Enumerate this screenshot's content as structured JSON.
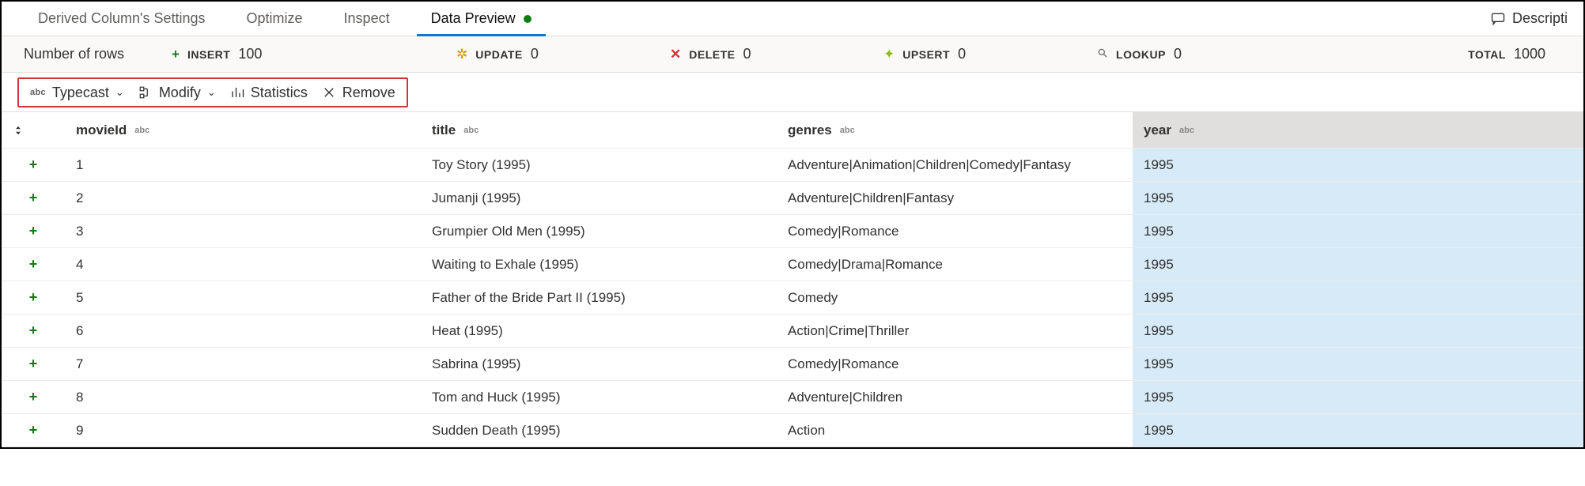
{
  "tabs": {
    "items": [
      {
        "label": "Derived Column's Settings",
        "active": false
      },
      {
        "label": "Optimize",
        "active": false
      },
      {
        "label": "Inspect",
        "active": false
      },
      {
        "label": "Data Preview",
        "active": true,
        "status": "green"
      }
    ],
    "descript_label": "Descripti"
  },
  "stats": {
    "label": "Number of rows",
    "insert": {
      "name": "INSERT",
      "value": "100"
    },
    "update": {
      "name": "UPDATE",
      "value": "0"
    },
    "delete": {
      "name": "DELETE",
      "value": "0"
    },
    "upsert": {
      "name": "UPSERT",
      "value": "0"
    },
    "lookup": {
      "name": "LOOKUP",
      "value": "0"
    },
    "total": {
      "name": "TOTAL",
      "value": "1000"
    }
  },
  "toolbar": {
    "typecast": "Typecast",
    "modify": "Modify",
    "statistics": "Statistics",
    "remove": "Remove"
  },
  "columns": [
    {
      "name": "movieId",
      "type": "abc",
      "highlight": false
    },
    {
      "name": "title",
      "type": "abc",
      "highlight": false
    },
    {
      "name": "genres",
      "type": "abc",
      "highlight": false
    },
    {
      "name": "year",
      "type": "abc",
      "highlight": true
    }
  ],
  "rows": [
    {
      "movieId": "1",
      "title": "Toy Story (1995)",
      "genres": "Adventure|Animation|Children|Comedy|Fantasy",
      "year": "1995"
    },
    {
      "movieId": "2",
      "title": "Jumanji (1995)",
      "genres": "Adventure|Children|Fantasy",
      "year": "1995"
    },
    {
      "movieId": "3",
      "title": "Grumpier Old Men (1995)",
      "genres": "Comedy|Romance",
      "year": "1995"
    },
    {
      "movieId": "4",
      "title": "Waiting to Exhale (1995)",
      "genres": "Comedy|Drama|Romance",
      "year": "1995"
    },
    {
      "movieId": "5",
      "title": "Father of the Bride Part II (1995)",
      "genres": "Comedy",
      "year": "1995"
    },
    {
      "movieId": "6",
      "title": "Heat (1995)",
      "genres": "Action|Crime|Thriller",
      "year": "1995"
    },
    {
      "movieId": "7",
      "title": "Sabrina (1995)",
      "genres": "Comedy|Romance",
      "year": "1995"
    },
    {
      "movieId": "8",
      "title": "Tom and Huck (1995)",
      "genres": "Adventure|Children",
      "year": "1995"
    },
    {
      "movieId": "9",
      "title": "Sudden Death (1995)",
      "genres": "Action",
      "year": "1995"
    }
  ]
}
